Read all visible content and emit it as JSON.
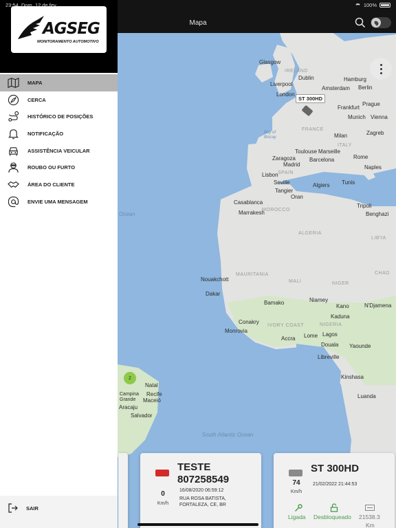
{
  "status_bar": {
    "time": "23:54",
    "date": "Dom. 12 de fev.",
    "battery": "100%"
  },
  "header": {
    "title": "Mapa"
  },
  "brand": {
    "name": "AGSEG",
    "tagline": "MONITORAMENTO AUTOMOTIVO"
  },
  "menu": {
    "items": [
      {
        "label": "MAPA",
        "icon": "map-icon",
        "active": true
      },
      {
        "label": "CERCA",
        "icon": "compass-icon",
        "active": false
      },
      {
        "label": "HISTÓRICO DE POSIÇÕES",
        "icon": "route-icon",
        "active": false
      },
      {
        "label": "NOTIFICAÇÃO",
        "icon": "bell-icon",
        "active": false
      },
      {
        "label": "ASSISTÊNCIA VEICULAR",
        "icon": "car-assist-icon",
        "active": false
      },
      {
        "label": "ROUBO OU FURTO",
        "icon": "thief-icon",
        "active": false
      },
      {
        "label": "ÁREA DO CLIENTE",
        "icon": "handshake-icon",
        "active": false
      },
      {
        "label": "ENVIE UMA MENSAGEM",
        "icon": "at-icon",
        "active": false
      }
    ],
    "logout_label": "SAIR"
  },
  "map": {
    "labels": {
      "glasgow": "Glasgow",
      "ireland": "IRELAND",
      "dublin": "Dublin",
      "liverpool": "Liverpool",
      "hamburg": "Hamburg",
      "amsterdam": "Amsterdam",
      "berlin": "Berlin",
      "london": "London",
      "frankfurt": "Frankfurt",
      "prague": "Prague",
      "munich": "Munich",
      "vienna": "Vienna",
      "france": "FRANCE",
      "milan": "Milan",
      "italy": "ITALY",
      "zagreb": "Zagreb",
      "toulouse": "Toulouse",
      "marseille": "Marseille",
      "zaragoza": "Zaragoza",
      "madrid": "Madrid",
      "barcelona": "Barcelona",
      "rome": "Rome",
      "naples": "Naples",
      "spain": "SPAIN",
      "lisbon": "Lisbon",
      "seville": "Seville",
      "tangier": "Tangier",
      "algiers": "Algiers",
      "tunis": "Tunis",
      "oran": "Oran",
      "casablanca": "Casablanca",
      "marrakesh": "Marrakesh",
      "morocco": "MOROCCO",
      "tripoli": "Tripoli",
      "benghazi": "Benghazi",
      "algeria": "ALGERIA",
      "libya": "LIBYA",
      "mauritania": "MAURITANIA",
      "mali": "MALI",
      "niger": "NIGER",
      "chad": "CHAD",
      "nouakchott": "Nouakchott",
      "dakar": "Dakar",
      "bamako": "Bamako",
      "niamey": "Niamey",
      "kano": "Kano",
      "ndjamena": "N'Djamena",
      "conakry": "Conakry",
      "monrovia": "Monrovia",
      "ivory_coast": "IVORY COAST",
      "accra": "Accra",
      "lome": "Lome",
      "lagos": "Lagos",
      "nigeria": "NIGERIA",
      "kaduna": "Kaduna",
      "douala": "Douala",
      "yaounde": "Yaounde",
      "libreville": "Libreville",
      "kinshasa": "Kinshasa",
      "luanda": "Luanda",
      "natal": "Natal",
      "recife": "Recife",
      "maceio": "Maceió",
      "salvador": "Salvador",
      "aracaju": "Aracaju",
      "campina": "Campina Grande",
      "south_atlantic": "South Atlantic Ocean",
      "bay_biscay": "Bay of Biscay",
      "ocean": "Ocean"
    },
    "vehicle_tag": "ST 300HD",
    "cluster_count": "2"
  },
  "cards": [
    {
      "name_line1": "TESTE",
      "name_line2": "807258549",
      "speed": "0",
      "speed_unit": "Km/h",
      "datetime": "16/08/2020 06:59:12",
      "address": "RUA ROSA BATISTA, FORTALEZA, CE, BR"
    },
    {
      "name": "ST 300HD",
      "speed": "74",
      "speed_unit": "Km/h",
      "datetime": "21/02/2022 21:44:53",
      "ignition": "Ligada",
      "lock": "Desbloqueado",
      "odometer": "21538.3",
      "odometer_unit": "Km"
    }
  ],
  "colors": {
    "sidebar_active": "#b5b5b5",
    "ocean": "#8fb7df",
    "land": "#e0e0df",
    "status_green": "#4a9a4a",
    "vehicle_red": "#d42a2a"
  }
}
